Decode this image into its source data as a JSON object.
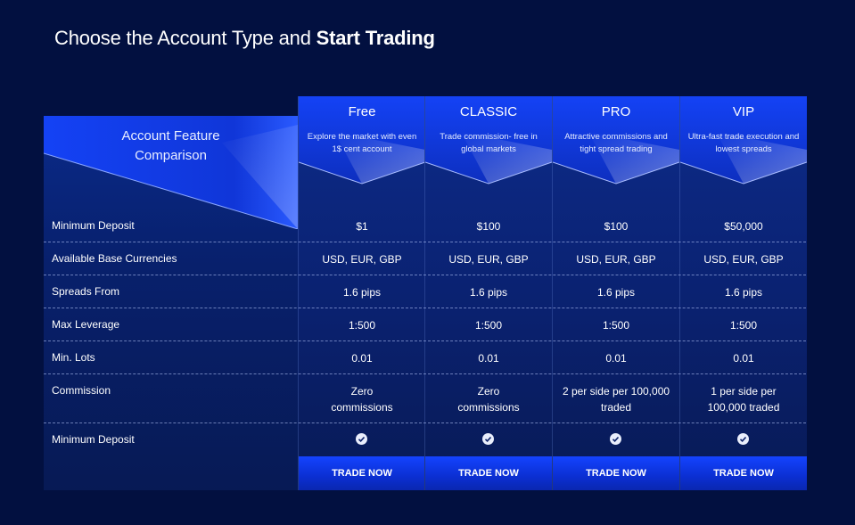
{
  "header": {
    "title_plain": "Choose the Account Type and ",
    "title_bold": "Start Trading"
  },
  "table": {
    "corner_title": [
      "Account Feature",
      "Comparison"
    ],
    "row_labels": [
      "Minimum Deposit",
      "Available Base Currencies",
      "Spreads From",
      "Max Leverage",
      "Min. Lots",
      "Commission",
      "Minimum Deposit"
    ],
    "plans": [
      {
        "name": "Free",
        "description": "Explore the market with even 1$ cent account",
        "min_deposit": "$1",
        "currencies": "USD, EUR, GBP",
        "spreads": "1.6 pips",
        "leverage": "1:500",
        "min_lots": "0.01",
        "commission": [
          "Zero",
          "commissions"
        ],
        "trade_label": "TRADE NOW"
      },
      {
        "name": "CLASSIC",
        "description": "Trade commission- free in global markets",
        "min_deposit": "$100",
        "currencies": "USD, EUR, GBP",
        "spreads": "1.6 pips",
        "leverage": "1:500",
        "min_lots": "0.01",
        "commission": [
          "Zero",
          "commissions"
        ],
        "trade_label": "TRADE NOW"
      },
      {
        "name": "PRO",
        "description": "Attractive commissions and tight spread trading",
        "min_deposit": "$100",
        "currencies": "USD, EUR, GBP",
        "spreads": "1.6 pips",
        "leverage": "1:500",
        "min_lots": "0.01",
        "commission": [
          "2 per side per 100,000",
          "traded"
        ],
        "trade_label": "TRADE NOW"
      },
      {
        "name": "VIP",
        "description": "Ultra-fast trade execution and lowest spreads",
        "min_deposit": "$50,000",
        "currencies": "USD, EUR, GBP",
        "spreads": "1.6 pips",
        "leverage": "1:500",
        "min_lots": "0.01",
        "commission": [
          "1 per side per",
          "100,000 traded"
        ],
        "trade_label": "TRADE NOW"
      }
    ]
  },
  "icons": {
    "check": "check-circle-icon"
  },
  "colors": {
    "background": "#021040",
    "button": "#1443ff"
  }
}
